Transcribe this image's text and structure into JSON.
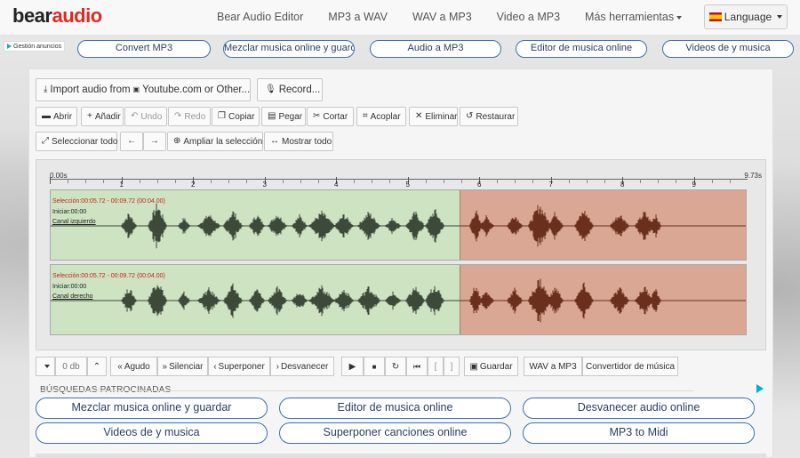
{
  "logo": {
    "part1": "bear",
    "part2": "audio"
  },
  "nav": [
    "Bear Audio Editor",
    "MP3 a WAV",
    "WAV a MP3",
    "Video a MP3",
    "Más herramientas"
  ],
  "language_label": "Language",
  "ad_choice_label": "Gestión anuncios",
  "ad_links": [
    "Convert MP3",
    "Mezclar musica online y guardar",
    "Audio a MP3",
    "Editor de musica online",
    "Videos de y musica"
  ],
  "import_btn": "Import audio from ",
  "import_site": "Youtube.com or Other...",
  "record_btn": "Record...",
  "toolbar1": [
    {
      "label": "Abrir",
      "icon": "folder-icon"
    },
    {
      "label": "Añadir",
      "icon": "plus-icon"
    },
    {
      "label": "Undo",
      "icon": "undo-icon"
    },
    {
      "label": "Redo",
      "icon": "redo-icon"
    },
    {
      "label": "Copiar",
      "icon": "copy-icon"
    },
    {
      "label": "Pegar",
      "icon": "paste-icon"
    },
    {
      "label": "Cortar",
      "icon": "scissors-icon"
    },
    {
      "label": "Acoplar",
      "icon": "crop-icon"
    },
    {
      "label": "Eliminar",
      "icon": "delete-icon"
    },
    {
      "label": "Restaurar",
      "icon": "restore-icon"
    }
  ],
  "toolbar2": [
    {
      "label": "Seleccionar todo",
      "icon": "expand-icon"
    },
    {
      "label": "",
      "icon": "arrow-left-icon"
    },
    {
      "label": "",
      "icon": "arrow-right-icon"
    },
    {
      "label": "Ampliar la selección",
      "icon": "zoom-in-icon"
    },
    {
      "label": "Mostrar todo",
      "icon": "fit-width-icon"
    }
  ],
  "ruler": {
    "start": "0.00s",
    "end": "9.73s",
    "labels": [
      "1",
      "2",
      "3",
      "4",
      "5",
      "6",
      "7",
      "8",
      "9"
    ]
  },
  "tracks": [
    {
      "selection": "Selección:00:05.72 - 00:09.72 (00:04.00)",
      "start": "Iniciar:00:00",
      "channel": "Canal izquierdo"
    },
    {
      "selection": "Selección:00:05.72 - 00:09.72 (00:04.00)",
      "start": "Iniciar:00:00",
      "channel": "Canal derecho"
    }
  ],
  "controls": {
    "gain": "0 db",
    "agudo": "Agudo",
    "silenciar": "Silenciar",
    "superponer": "Superponer",
    "desvanecer": "Desvanecer",
    "guardar": "Guardar",
    "wav_mp3": "WAV a MP3",
    "convertidor": "Convertidor de música"
  },
  "sponsored_title": "BÚSQUEDAS PATROCINADAS",
  "sponsored_links": [
    "Mezclar musica online y guardar",
    "Editor de musica online",
    "Desvanecer audio online",
    "Videos de y musica",
    "Superponer canciones online",
    "MP3 to Midi"
  ],
  "colors": {
    "brand_red": "#e0291f",
    "unselected_region": "#cde3c1",
    "selected_region": "#d9a794",
    "pill_border": "#3a6fb1"
  }
}
